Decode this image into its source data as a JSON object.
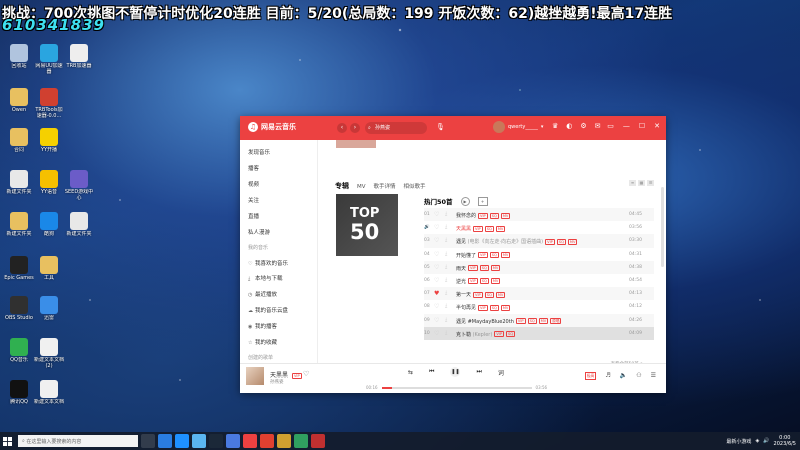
{
  "overlay": {
    "line1": "挑战：700次挑图不暂停计时优化20连胜    目前：5/20(总局数：199 开饭次数：62)越挫越勇!最高17连胜",
    "line2": "610341839"
  },
  "desktop_icons": [
    {
      "label": "回收站",
      "color": "#b0c4de"
    },
    {
      "label": "网易UU加速器",
      "color": "#2aa5e0"
    },
    {
      "label": "TRB加速器",
      "color": "#eeeeee"
    },
    {
      "label": "Owen",
      "color": "#e8c060"
    },
    {
      "label": "TRBTools加速器-0.0...",
      "color": "#d04030"
    },
    {
      "label": "合同",
      "color": "#e8c060"
    },
    {
      "label": "YY开播",
      "color": "#f5d000"
    },
    {
      "label": "新建文件夹",
      "color": "#e8e8e8"
    },
    {
      "label": "YY语音",
      "color": "#f5c000"
    },
    {
      "label": "SEED游戏中心",
      "color": "#6b5cc8"
    },
    {
      "label": "新建文件夹",
      "color": "#e8c060"
    },
    {
      "label": "酷狗",
      "color": "#1a88e8"
    },
    {
      "label": "新建文件夹",
      "color": "#e8e8e8"
    },
    {
      "label": "Epic Games",
      "color": "#222222"
    },
    {
      "label": "工具",
      "color": "#e8c060"
    },
    {
      "label": "OBS Studio",
      "color": "#303030"
    },
    {
      "label": "迅雷",
      "color": "#3a8ee8"
    },
    {
      "label": "QQ音乐",
      "color": "#30b050"
    },
    {
      "label": "新建文本文档 (2)",
      "color": "#f0f0f0"
    },
    {
      "label": "腾讯QQ",
      "color": "#111111"
    },
    {
      "label": "新建文本文档",
      "color": "#f0f0f0"
    }
  ],
  "taskbar": {
    "search_placeholder": "在这里输入要搜索的内容",
    "tray_app": "最新小游戏",
    "time": "0:00",
    "date": "2023/6/5"
  },
  "app": {
    "name": "网易云音乐",
    "search_query": "孙燕姿",
    "username": "qwerty_____",
    "vip_label": "VIP"
  },
  "sidebar": {
    "items": [
      {
        "label": "发现音乐",
        "section": false
      },
      {
        "label": "播客",
        "section": false
      },
      {
        "label": "视频",
        "section": false
      },
      {
        "label": "关注",
        "section": false
      },
      {
        "label": "直播",
        "section": false
      },
      {
        "label": "私人漫游",
        "section": false
      },
      {
        "label": "我的音乐",
        "section": true
      },
      {
        "label": "我喜欢的音乐",
        "section": false
      },
      {
        "label": "本地与下载",
        "section": false
      },
      {
        "label": "最近播放",
        "section": false
      },
      {
        "label": "我的音乐云盘",
        "section": false
      },
      {
        "label": "我的播客",
        "section": false
      },
      {
        "label": "我的收藏",
        "section": false
      },
      {
        "label": "创建的歌单",
        "section": true
      }
    ]
  },
  "main": {
    "tabs": [
      "专辑",
      "MV",
      "歌手详情",
      "相似歌手"
    ],
    "cover_text": [
      "TOP",
      "50"
    ],
    "list_title": "热门50首",
    "see_all": "查看全部50首 >",
    "songs": [
      {
        "index": "01",
        "title": "我怀念的",
        "sub": "",
        "badges": [
          "VIP",
          "SQ",
          "MV"
        ],
        "duration": "04:45",
        "liked": false,
        "playing": false
      },
      {
        "index": "02",
        "title": "天黑黑",
        "sub": "",
        "badges": [
          "VIP",
          "SQ",
          "MV"
        ],
        "duration": "03:56",
        "liked": false,
        "playing": true
      },
      {
        "index": "03",
        "title": "遇见",
        "sub": "(电影《向左走·向右走》国语插曲)",
        "badges": [
          "VIP",
          "SQ",
          "MV"
        ],
        "duration": "03:30",
        "liked": false,
        "playing": false
      },
      {
        "index": "04",
        "title": "开始懂了",
        "sub": "",
        "badges": [
          "VIP",
          "SQ",
          "MV"
        ],
        "duration": "04:31",
        "liked": false,
        "playing": false
      },
      {
        "index": "05",
        "title": "雨天",
        "sub": "",
        "badges": [
          "VIP",
          "SQ",
          "MV"
        ],
        "duration": "04:38",
        "liked": false,
        "playing": false
      },
      {
        "index": "06",
        "title": "逆光",
        "sub": "",
        "badges": [
          "VIP",
          "SQ",
          "MV"
        ],
        "duration": "04:54",
        "liked": false,
        "playing": false
      },
      {
        "index": "07",
        "title": "第一天",
        "sub": "",
        "badges": [
          "VIP",
          "SQ",
          "MV"
        ],
        "duration": "04:13",
        "liked": true,
        "playing": false
      },
      {
        "index": "08",
        "title": "半句再见",
        "sub": "",
        "badges": [
          "VIP",
          "SQ",
          "MV"
        ],
        "duration": "04:12",
        "liked": false,
        "playing": false
      },
      {
        "index": "09",
        "title": "遇见 #MaydayBlue20th",
        "sub": "",
        "badges": [
          "VIP",
          "SQ",
          "MV",
          "原唱"
        ],
        "duration": "04:26",
        "liked": false,
        "playing": false
      },
      {
        "index": "10",
        "title": "克卜勒",
        "sub": "(Kepler)",
        "badges": [
          "VIP",
          "SQ"
        ],
        "duration": "04:09",
        "liked": false,
        "playing": false
      }
    ]
  },
  "player": {
    "now_title": "天黑黑",
    "now_badge": "VIP",
    "now_artist": "孙燕姿",
    "elapsed": "00:16",
    "total": "03:56",
    "progress": 0.07,
    "ext_label": "极高",
    "accent": "#ec4141"
  }
}
